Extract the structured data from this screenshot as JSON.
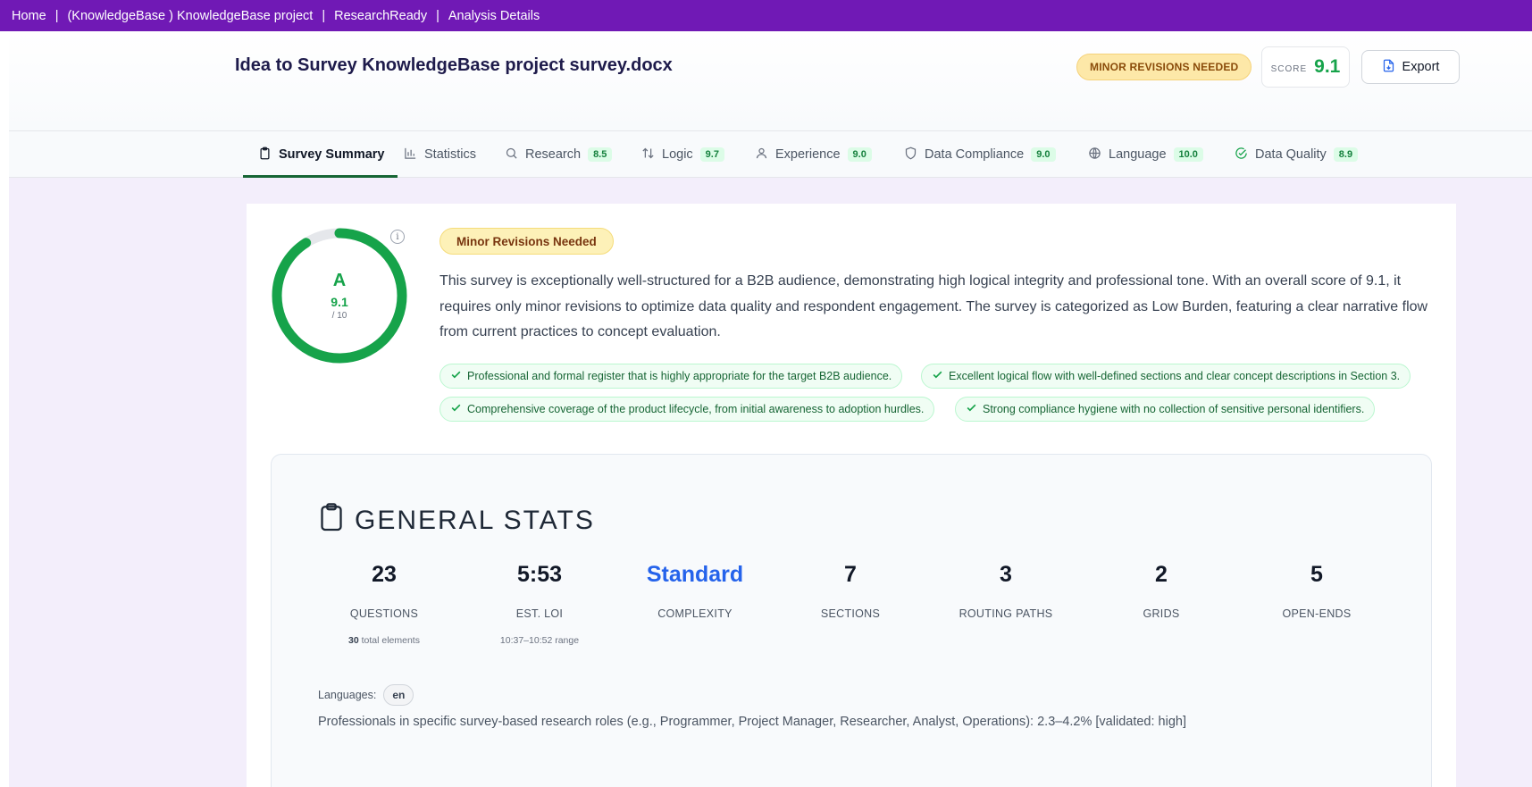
{
  "breadcrumb": {
    "items": [
      "Home",
      "(KnowledgeBase ) KnowledgeBase project",
      "ResearchReady",
      "Analysis Details"
    ],
    "separator": "|"
  },
  "header": {
    "title": "Idea to Survey KnowledgeBase project survey.docx",
    "status": "MINOR REVISIONS NEEDED",
    "score_label": "SCORE",
    "score_value": "9.1",
    "export_label": "Export"
  },
  "tabs": [
    {
      "label": "Survey Summary",
      "icon": "clipboard-icon",
      "active": true
    },
    {
      "label": "Statistics",
      "icon": "bar-chart-icon"
    },
    {
      "label": "Research",
      "icon": "search-icon",
      "score": "8.5"
    },
    {
      "label": "Logic",
      "icon": "sort-arrows-icon",
      "score": "9.7"
    },
    {
      "label": "Experience",
      "icon": "user-icon",
      "score": "9.0"
    },
    {
      "label": "Data Compliance",
      "icon": "shield-icon",
      "score": "9.0"
    },
    {
      "label": "Language",
      "icon": "globe-icon",
      "score": "10.0"
    },
    {
      "label": "Data Quality",
      "icon": "check-circle-icon",
      "score": "8.9"
    }
  ],
  "summary": {
    "grade": "A",
    "score": "9.1",
    "score_max": "/ 10",
    "score_fraction": 0.91,
    "status": "Minor Revisions Needed",
    "text": "This survey is exceptionally well-structured for a B2B audience, demonstrating high logical integrity and professional tone. With an overall score of 9.1, it requires only minor revisions to optimize data quality and respondent engagement. The survey is categorized as Low Burden, featuring a clear narrative flow from current practices to concept evaluation.",
    "strengths": [
      "Professional and formal register that is highly appropriate for the target B2B audience.",
      "Excellent logical flow with well-defined sections and clear concept descriptions in Section 3.",
      "Comprehensive coverage of the product lifecycle, from initial awareness to adoption hurdles.",
      "Strong compliance hygiene with no collection of sensitive personal identifiers."
    ]
  },
  "general_stats": {
    "title": "GENERAL STATS",
    "items": [
      {
        "value": "23",
        "label": "QUESTIONS",
        "sub_bold": "30",
        "sub": "total elements"
      },
      {
        "value": "5:53",
        "label": "EST. LOI",
        "sub": "10:37–10:52 range"
      },
      {
        "value": "Standard",
        "label": "COMPLEXITY",
        "highlight": true
      },
      {
        "value": "7",
        "label": "SECTIONS"
      },
      {
        "value": "3",
        "label": "ROUTING PATHS"
      },
      {
        "value": "2",
        "label": "GRIDS"
      },
      {
        "value": "5",
        "label": "OPEN-ENDS"
      }
    ],
    "languages_label": "Languages:",
    "languages": [
      "en"
    ],
    "audience": "Professionals in specific survey-based research roles (e.g., Programmer, Project Manager, Researcher, Analyst, Operations): 2.3–4.2% [validated: high]"
  },
  "colors": {
    "topbar": "#7019b5",
    "accent_green": "#16a34a",
    "status_amber": "#fde8a8",
    "complexity_blue": "#2563eb",
    "page_bg": "#f3eefb"
  }
}
